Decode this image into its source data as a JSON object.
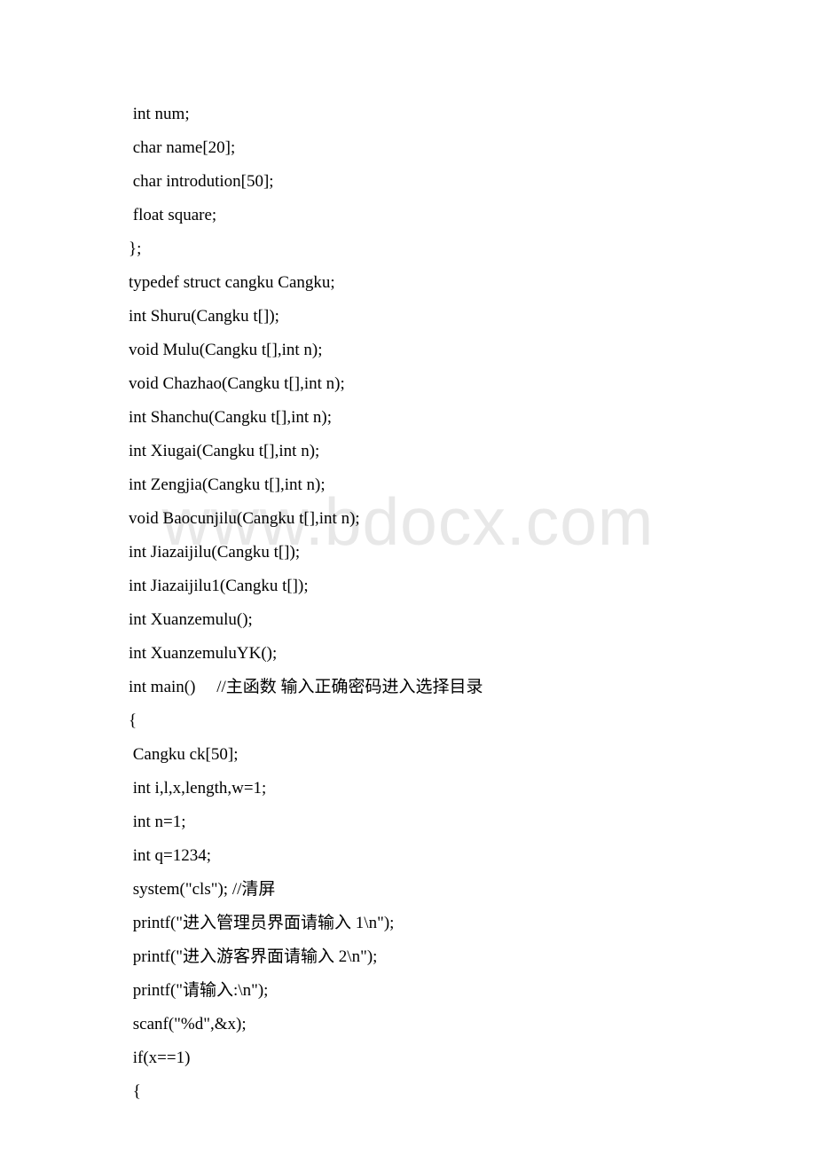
{
  "watermark": "www.bdocx.com",
  "code": {
    "lines": [
      " int num;",
      " char name[20];",
      " char introdution[50];",
      " float square;",
      "};",
      "typedef struct cangku Cangku;",
      "int Shuru(Cangku t[]);",
      "void Mulu(Cangku t[],int n);",
      "void Chazhao(Cangku t[],int n);",
      "int Shanchu(Cangku t[],int n);",
      "int Xiugai(Cangku t[],int n);",
      "int Zengjia(Cangku t[],int n);",
      "void Baocunjilu(Cangku t[],int n);",
      "int Jiazaijilu(Cangku t[]);",
      "int Jiazaijilu1(Cangku t[]);",
      "int Xuanzemulu();",
      "int XuanzemuluYK();",
      "int main()     //主函数 输入正确密码进入选择目录",
      "{",
      " Cangku ck[50];",
      " int i,l,x,length,w=1;",
      " int n=1;",
      " int q=1234;",
      " system(\"cls\"); //清屏",
      " printf(\"进入管理员界面请输入 1\\n\");",
      " printf(\"进入游客界面请输入 2\\n\");",
      " printf(\"请输入:\\n\");",
      " scanf(\"%d\",&x);",
      " if(x==1)",
      " {"
    ]
  }
}
